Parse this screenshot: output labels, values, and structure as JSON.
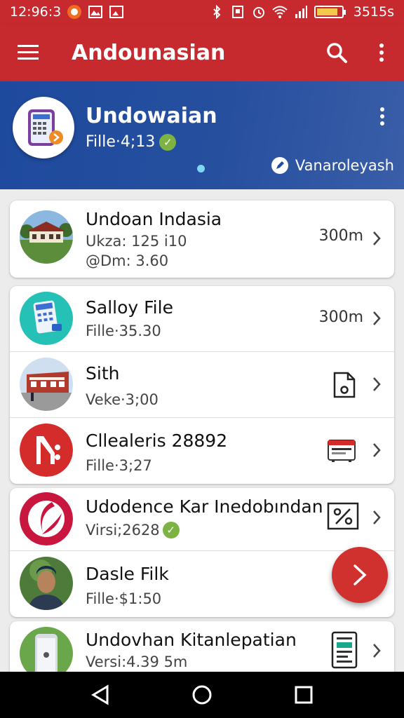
{
  "status_bar": {
    "time": "12:96:3",
    "battery_text": "3515s",
    "battery_level": 0.85
  },
  "app_bar": {
    "title": "Andounasian",
    "icons": [
      "menu-icon",
      "search-icon",
      "more-vert-icon"
    ]
  },
  "header": {
    "title": "Undowaian",
    "subtitle": "Fille·4;13",
    "link_label": "Vanaroleyash",
    "verified": true
  },
  "list": [
    {
      "title": "Undoan Indasia",
      "subtitle": "Ukza: 125 i10",
      "subtitle2": "@Dm: 3.60",
      "right": "300m",
      "thumb": "school-building-photo"
    },
    {
      "title": "Salloy File",
      "subtitle": "Fille·35.30",
      "right": "300m",
      "thumb": "calculator-icon"
    },
    {
      "title": "Sith",
      "subtitle": "Veke·3;00",
      "right_icon": "file-icon",
      "thumb": "building-photo"
    },
    {
      "title": "Cllealeris 28892",
      "subtitle": "Fille·3;27",
      "right_icon": "ticket-icon",
      "thumb": "brand-logo"
    },
    {
      "title": "Udodence Kar Inedobından",
      "subtitle": "Virsi;2628",
      "verified": true,
      "right_icon": "percent-icon",
      "thumb": "red-swirl-logo"
    },
    {
      "title": "Dasle Filk",
      "subtitle": "Fille·$1:50",
      "thumb": "person-photo"
    },
    {
      "title": "Undovhan Kitanlepatian",
      "subtitle": "Versi:4.39 5m",
      "right_icon": "document-icon",
      "thumb": "phone-photo"
    }
  ],
  "colors": {
    "primary": "#c62a2f",
    "header_blue": "#234c9f",
    "fab": "#d0302e",
    "verified_green": "#7cb342"
  }
}
